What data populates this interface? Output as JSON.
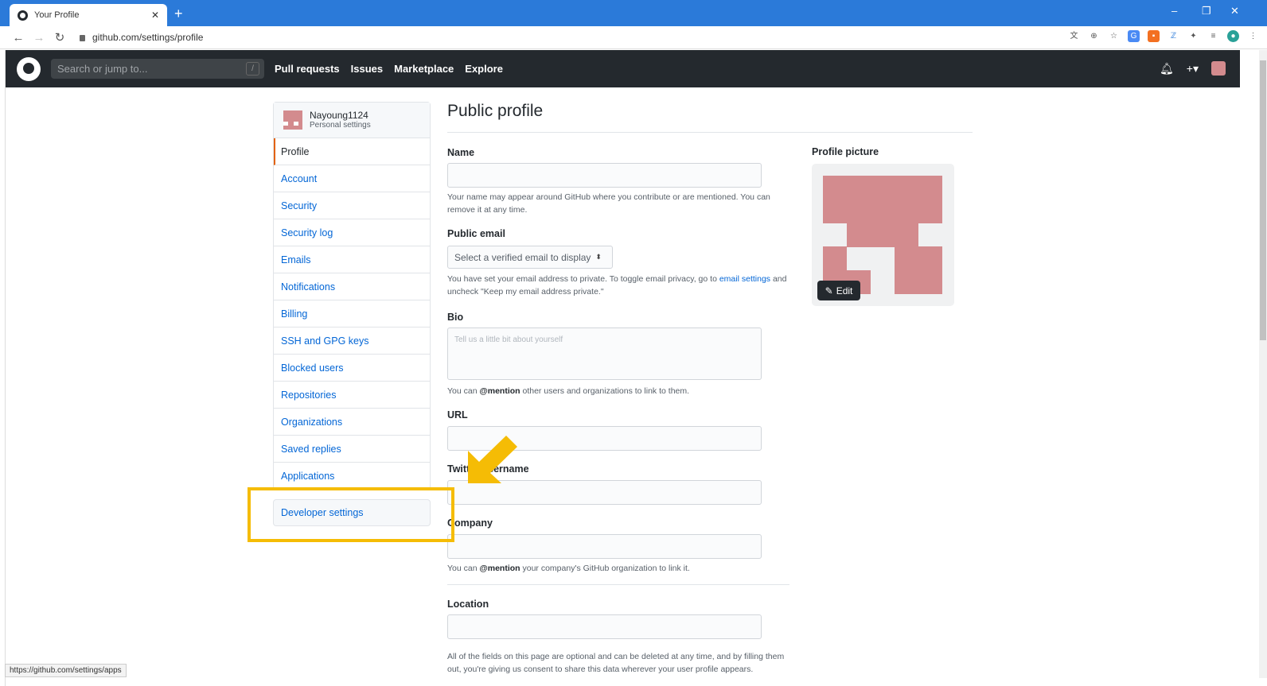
{
  "browser": {
    "tab_title": "Your Profile",
    "tab_close": "✕",
    "new_tab": "+",
    "url": "github.com/settings/profile",
    "status_url": "https://github.com/settings/apps"
  },
  "header": {
    "search_placeholder": "Search or jump to...",
    "search_shortcut": "/",
    "nav": [
      "Pull requests",
      "Issues",
      "Marketplace",
      "Explore"
    ]
  },
  "sidebar": {
    "username": "Nayoung1124",
    "subtitle": "Personal settings",
    "items": [
      {
        "label": "Profile",
        "active": true
      },
      {
        "label": "Account"
      },
      {
        "label": "Security"
      },
      {
        "label": "Security log"
      },
      {
        "label": "Emails"
      },
      {
        "label": "Notifications"
      },
      {
        "label": "Billing"
      },
      {
        "label": "SSH and GPG keys"
      },
      {
        "label": "Blocked users"
      },
      {
        "label": "Repositories"
      },
      {
        "label": "Organizations"
      },
      {
        "label": "Saved replies"
      },
      {
        "label": "Applications"
      }
    ],
    "developer_settings": "Developer settings"
  },
  "main": {
    "title": "Public profile",
    "name_label": "Name",
    "name_note": "Your name may appear around GitHub where you contribute or are mentioned. You can remove it at any time.",
    "email_label": "Public email",
    "email_select": "Select a verified email to display",
    "email_note_1": "You have set your email address to private. To toggle email privacy, go to",
    "email_note_link": "email settings",
    "email_note_2": "and uncheck \"Keep my email address private.\"",
    "bio_label": "Bio",
    "bio_placeholder": "Tell us a little bit about yourself",
    "bio_note_1": "You can",
    "bio_note_mention": "@mention",
    "bio_note_2": "other users and organizations to link to them.",
    "url_label": "URL",
    "twitter_label": "Twitter username",
    "company_label": "Company",
    "company_note_1": "You can",
    "company_note_mention": "@mention",
    "company_note_2": "your company's GitHub organization to link it.",
    "location_label": "Location",
    "footer_note": "All of the fields on this page are optional and can be deleted at any time, and by filling them out, you're giving us consent to share this data wherever your user profile appears."
  },
  "profile_picture": {
    "label": "Profile picture",
    "edit_button": "Edit",
    "avatar_color": "#d38b8e"
  },
  "annotation": {
    "highlight_color": "#f5bc05"
  }
}
